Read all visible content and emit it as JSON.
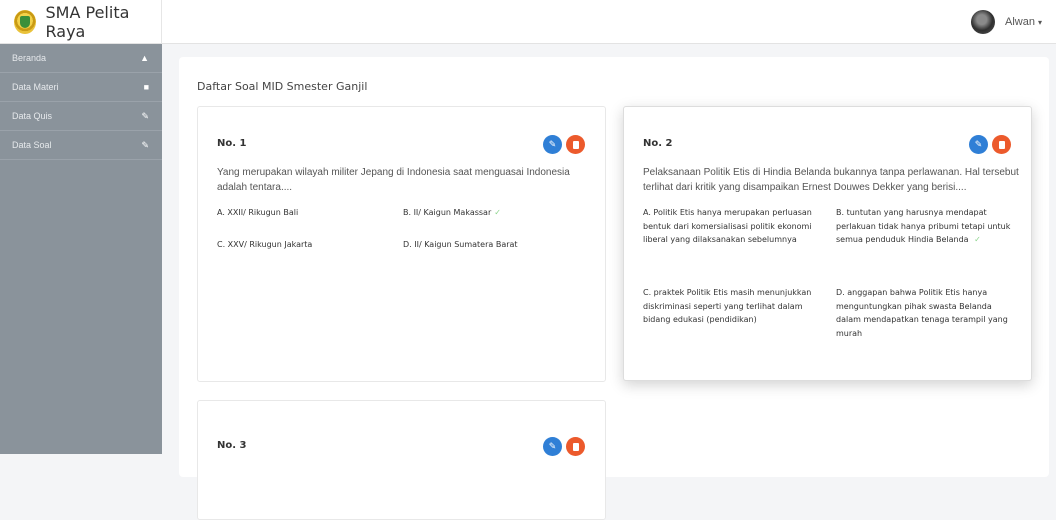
{
  "header": {
    "app_name": "SMA Pelita Raya",
    "logo_icon": "school-logo-icon",
    "user_name": "Alwan",
    "caret": "▾"
  },
  "sidebar": {
    "items": [
      {
        "label": "Beranda",
        "icon": "home-icon",
        "glyph": "▲"
      },
      {
        "label": "Data Materi",
        "icon": "book-icon",
        "glyph": "■"
      },
      {
        "label": "Data Quis",
        "icon": "pencil-icon",
        "glyph": "✎"
      },
      {
        "label": "Data Soal",
        "icon": "pencil-icon",
        "glyph": "✎"
      }
    ]
  },
  "main": {
    "title": "Daftar Soal MID Smester Ganjil",
    "edit_glyph": "✎",
    "correct_mark": "✓",
    "colors": {
      "edit_button": "#2f7fd6",
      "delete_button": "#ec5a2c",
      "correct_check": "#8bd48b",
      "sidebar": "#8a939b"
    },
    "questions": [
      {
        "number": "No. 1",
        "text": "Yang merupakan wilayah militer Jepang di Indonesia saat menguasai Indonesia adalah tentara....",
        "options": [
          {
            "text": "A. XXII/ Rikugun Bali",
            "correct": false
          },
          {
            "text": "B. II/ Kaigun Makassar",
            "correct": true
          },
          {
            "text": "C. XXV/ Rikugun Jakarta",
            "correct": false
          },
          {
            "text": "D. II/ Kaigun Sumatera Barat",
            "correct": false
          }
        ]
      },
      {
        "number": "No. 2",
        "text": "Pelaksanaan Politik Etis di Hindia Belanda bukannya tanpa perlawanan. Hal tersebut terlihat dari kritik yang disampaikan Ernest Douwes Dekker yang berisi....",
        "options": [
          {
            "text": "A. Politik Etis hanya merupakan perluasan bentuk dari komersialisasi politik ekonomi liberal yang dilaksanakan sebelumnya",
            "correct": false
          },
          {
            "text": "B. tuntutan yang harusnya mendapat perlakuan tidak hanya pribumi tetapi untuk semua penduduk Hindia Belanda",
            "correct": true
          },
          {
            "text": "C. praktek Politik Etis masih menunjukkan diskriminasi seperti yang terlihat dalam bidang edukasi (pendidikan)",
            "correct": false
          },
          {
            "text": "D. anggapan bahwa Politik Etis hanya menguntungkan pihak swasta Belanda dalam mendapatkan tenaga terampil yang murah",
            "correct": false
          }
        ]
      },
      {
        "number": "No. 3"
      }
    ]
  }
}
